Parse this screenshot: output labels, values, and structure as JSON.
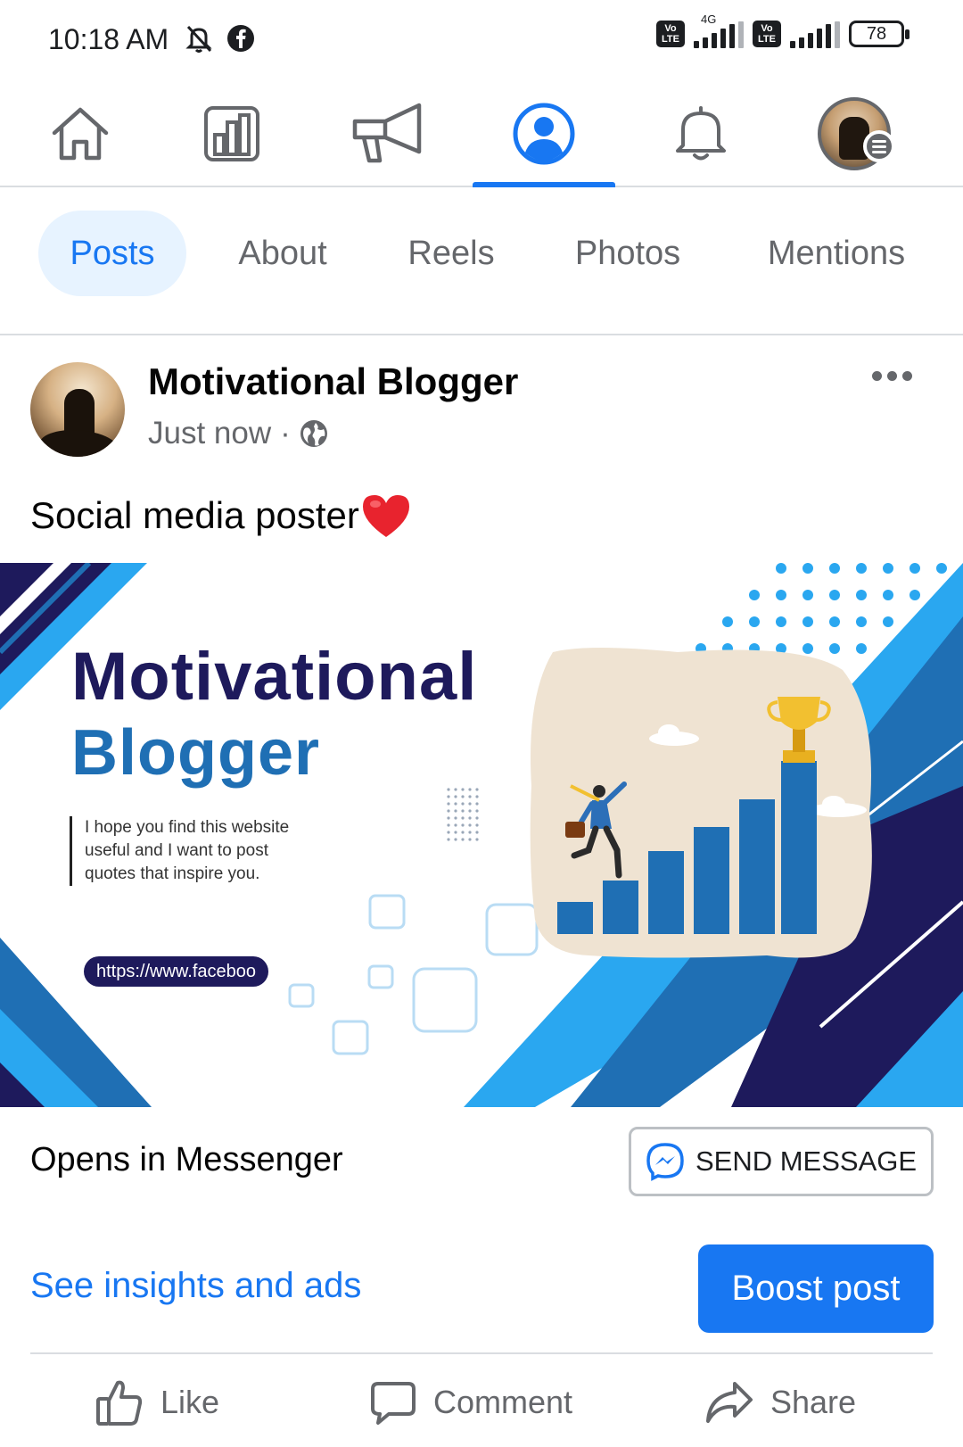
{
  "status_bar": {
    "time": "10:18 AM",
    "network_tag": "4G",
    "volte_label": "Vo LTE",
    "battery": "78"
  },
  "top_nav": {
    "items": [
      "home-icon",
      "insights-icon",
      "megaphone-icon",
      "profile-icon",
      "bell-icon",
      "avatar-menu"
    ],
    "active_index": 3
  },
  "tabs": [
    "Posts",
    "About",
    "Reels",
    "Photos",
    "Mentions"
  ],
  "post": {
    "author": "Motivational Blogger",
    "time": "Just now",
    "separator": "·",
    "text": "Social media poster",
    "emoji": "❤️"
  },
  "poster": {
    "title_line1": "Motivational",
    "title_line2": "Blogger",
    "description": "I hope you find this website useful and I want to post quotes that inspire you.",
    "url": "https://www.faceboo"
  },
  "cta": {
    "label": "Opens in Messenger",
    "button": "SEND MESSAGE"
  },
  "insights": {
    "link": "See insights and ads",
    "boost": "Boost post"
  },
  "actions": {
    "like": "Like",
    "comment": "Comment",
    "share": "Share"
  },
  "colors": {
    "accent": "#1877f2",
    "navy": "#1e1a5c",
    "blue": "#1f6fb4",
    "light_blue": "#2aa7f0",
    "text_secondary": "#65676b"
  }
}
